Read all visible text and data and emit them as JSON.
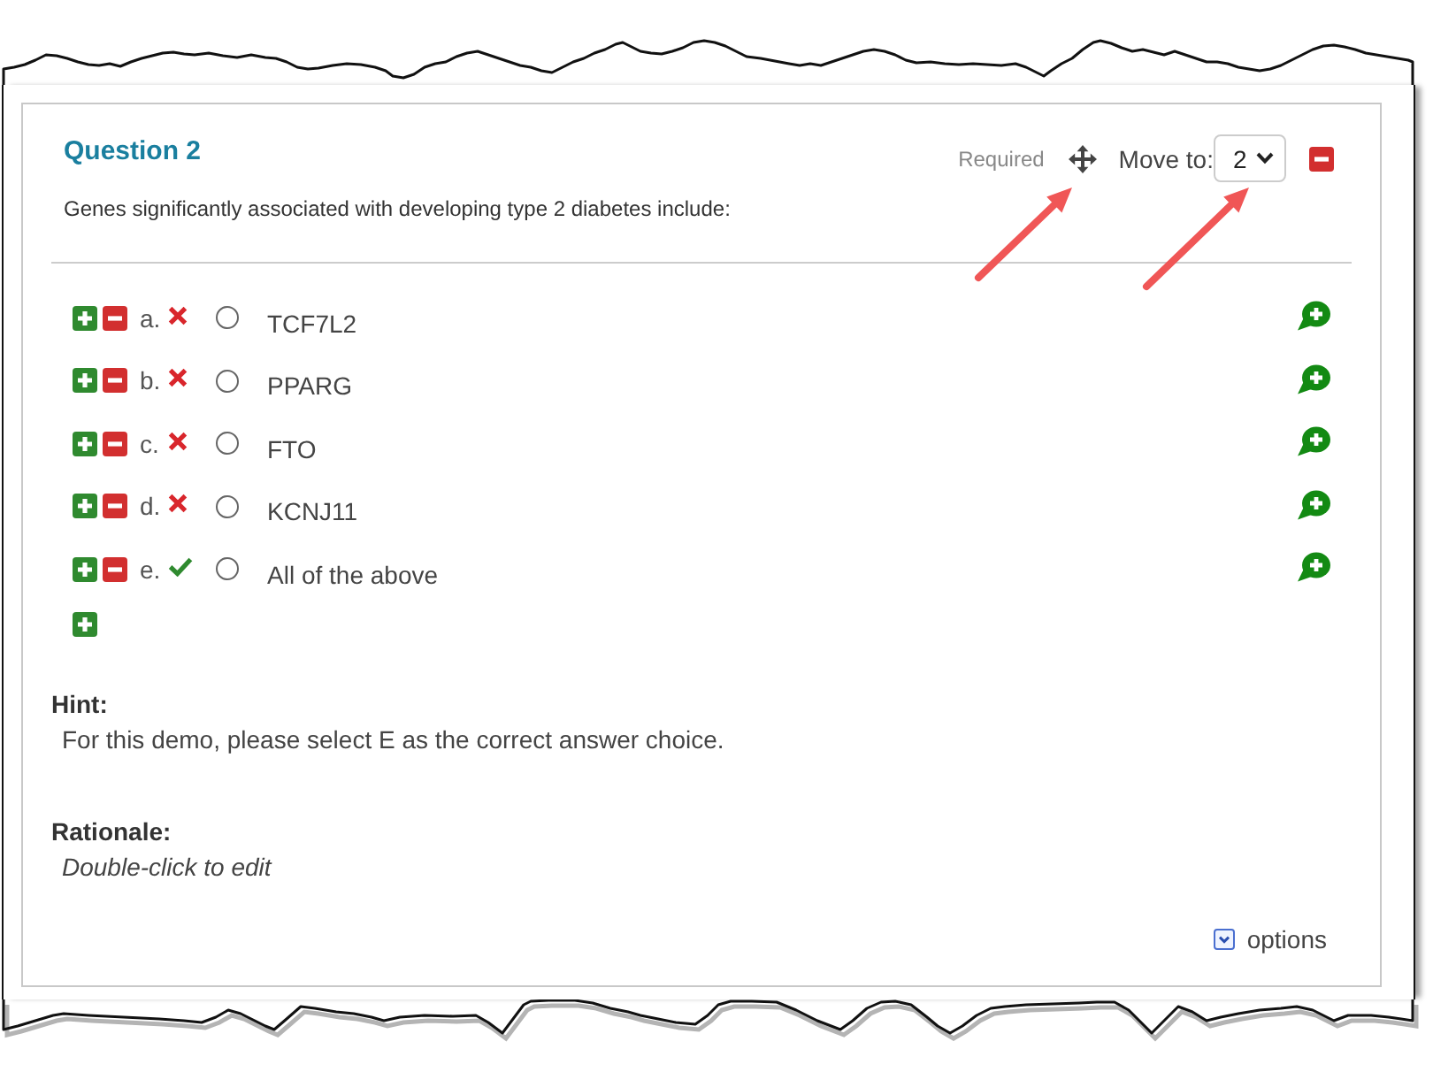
{
  "question": {
    "title": "Question 2",
    "prompt": "Genes significantly associated with developing type 2 diabetes include:",
    "required": {
      "label": "Required",
      "on": false
    },
    "move": {
      "label": "Move to:",
      "value": "2"
    }
  },
  "choices": [
    {
      "letter": "a.",
      "text": "TCF7L2",
      "correct": false,
      "selected": false
    },
    {
      "letter": "b.",
      "text": "PPARG",
      "correct": false,
      "selected": false
    },
    {
      "letter": "c.",
      "text": "FTO",
      "correct": false,
      "selected": false
    },
    {
      "letter": "d.",
      "text": "KCNJ11",
      "correct": false,
      "selected": false
    },
    {
      "letter": "e.",
      "text": "All of the above",
      "correct": true,
      "selected": false
    }
  ],
  "hint": {
    "label": "Hint:",
    "text": "For this demo, please select E as the correct answer choice."
  },
  "rationale": {
    "label": "Rationale:",
    "prompt": "Double-click to edit"
  },
  "options": {
    "label": "options"
  }
}
